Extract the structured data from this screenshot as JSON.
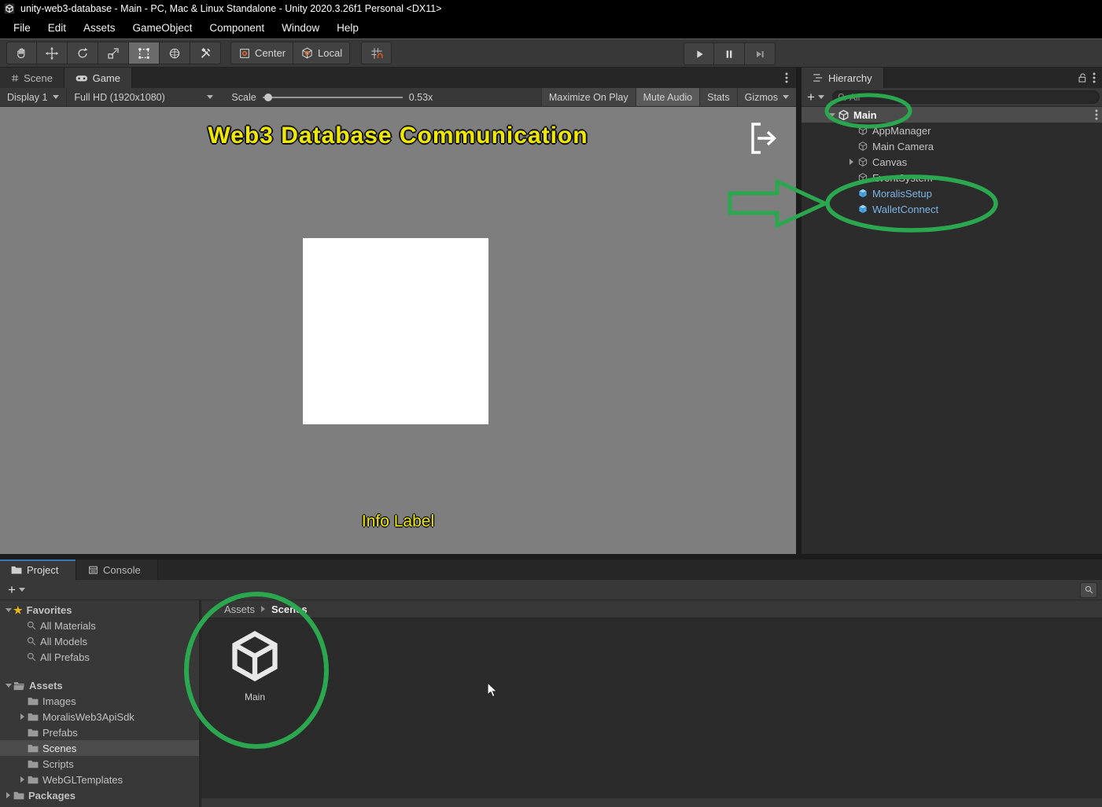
{
  "colors": {
    "accent-green": "#2ba84f",
    "overlay-yellow": "#efe800",
    "prefab-blue": "#7db4e6",
    "tab-active-blue": "#3c76b8"
  },
  "window": {
    "title": "unity-web3-database - Main - PC, Mac & Linux Standalone - Unity 2020.3.26f1 Personal <DX11>"
  },
  "menu": {
    "items": [
      "File",
      "Edit",
      "Assets",
      "GameObject",
      "Component",
      "Window",
      "Help"
    ]
  },
  "toolbar": {
    "center": "Center",
    "local": "Local"
  },
  "game_tabs": {
    "scene": "Scene",
    "game": "Game"
  },
  "game_controls": {
    "display": "Display 1",
    "resolution": "Full HD (1920x1080)",
    "scale_label": "Scale",
    "scale_value": "0.53x",
    "maximize": "Maximize On Play",
    "mute_audio": "Mute Audio",
    "stats": "Stats",
    "gizmos": "Gizmos"
  },
  "game_view": {
    "title": "Web3 Database Communication",
    "info_label": "Info Label"
  },
  "hierarchy": {
    "tab": "Hierarchy",
    "search_value": "All",
    "items": [
      {
        "label": "Main",
        "type": "scene"
      },
      {
        "label": "AppManager",
        "type": "object"
      },
      {
        "label": "Main Camera",
        "type": "object"
      },
      {
        "label": "Canvas",
        "type": "object"
      },
      {
        "label": "EventSystem",
        "type": "object"
      },
      {
        "label": "MoralisSetup",
        "type": "prefab"
      },
      {
        "label": "WalletConnect",
        "type": "prefab"
      }
    ]
  },
  "project": {
    "tab_project": "Project",
    "tab_console": "Console",
    "breadcrumb": {
      "root": "Assets",
      "current": "Scenes"
    },
    "favorites": {
      "label": "Favorites",
      "items": [
        "All Materials",
        "All Models",
        "All Prefabs"
      ]
    },
    "assets": {
      "label": "Assets",
      "items": [
        "Images",
        "MoralisWeb3ApiSdk",
        "Prefabs",
        "Scenes",
        "Scripts",
        "WebGLTemplates"
      ]
    },
    "packages": {
      "label": "Packages"
    },
    "asset": {
      "label": "Main"
    }
  }
}
